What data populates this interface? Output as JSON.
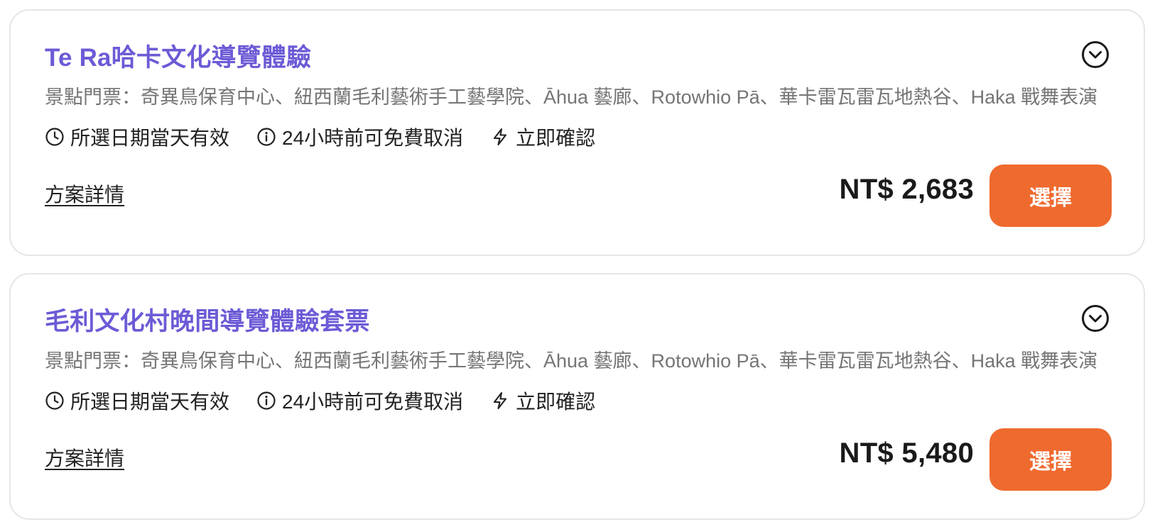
{
  "colors": {
    "title": "#6b5bd6",
    "description": "#757575",
    "text": "#222222",
    "button_bg": "#ef6a2e",
    "button_text": "#ffffff",
    "card_border": "#e6e6e6"
  },
  "packages": [
    {
      "title": "Te Ra哈卡文化導覽體驗",
      "description": "景點門票：奇異鳥保育中心、紐西蘭毛利藝術手工藝學院、Āhua 藝廊、Rotowhio Pā、華卡雷瓦雷瓦地熱谷、Haka 戰舞表演",
      "features": [
        {
          "icon": "clock-icon",
          "label": "所選日期當天有效"
        },
        {
          "icon": "info-icon",
          "label": "24小時前可免費取消"
        },
        {
          "icon": "lightning-icon",
          "label": "立即確認"
        }
      ],
      "details_label": "方案詳情",
      "price": "NT$ 2,683",
      "select_label": "選擇",
      "expand_icon": "chevron-down-circle-icon"
    },
    {
      "title": "毛利文化村晚間導覽體驗套票",
      "description": "景點門票：奇異鳥保育中心、紐西蘭毛利藝術手工藝學院、Āhua 藝廊、Rotowhio Pā、華卡雷瓦雷瓦地熱谷、Haka 戰舞表演",
      "features": [
        {
          "icon": "clock-icon",
          "label": "所選日期當天有效"
        },
        {
          "icon": "info-icon",
          "label": "24小時前可免費取消"
        },
        {
          "icon": "lightning-icon",
          "label": "立即確認"
        }
      ],
      "details_label": "方案詳情",
      "price": "NT$ 5,480",
      "select_label": "選擇",
      "expand_icon": "chevron-down-circle-icon"
    }
  ]
}
